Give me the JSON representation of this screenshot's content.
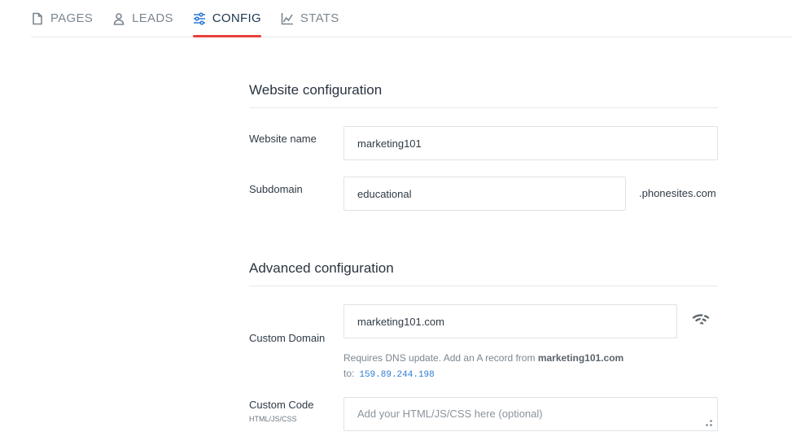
{
  "tabs": [
    {
      "label": "PAGES",
      "icon": "page-icon"
    },
    {
      "label": "LEADS",
      "icon": "user-icon"
    },
    {
      "label": "CONFIG",
      "icon": "sliders-icon",
      "active": true
    },
    {
      "label": "STATS",
      "icon": "chart-icon"
    }
  ],
  "website_config": {
    "title": "Website configuration",
    "name_label": "Website name",
    "name_value": "marketing101",
    "subdomain_label": "Subdomain",
    "subdomain_value": "educational",
    "subdomain_suffix": ".phonesites.com"
  },
  "advanced_config": {
    "title": "Advanced configuration",
    "domain_label": "Custom Domain",
    "domain_value": "marketing101.com",
    "status_icon": "wifi-off-icon",
    "hint_prefix": "Requires DNS update. Add an A record from",
    "hint_domain": "marketing101.com",
    "hint_to": "to:",
    "hint_ip": "159.89.244.198",
    "code_label": "Custom Code",
    "code_sublabel": "HTML/JS/CSS",
    "code_placeholder": "Add your HTML/JS/CSS here (optional)"
  },
  "colors": {
    "accent": "#e8413d",
    "active_icon": "#2f7bd6",
    "ip_text": "#2f7bd6"
  }
}
